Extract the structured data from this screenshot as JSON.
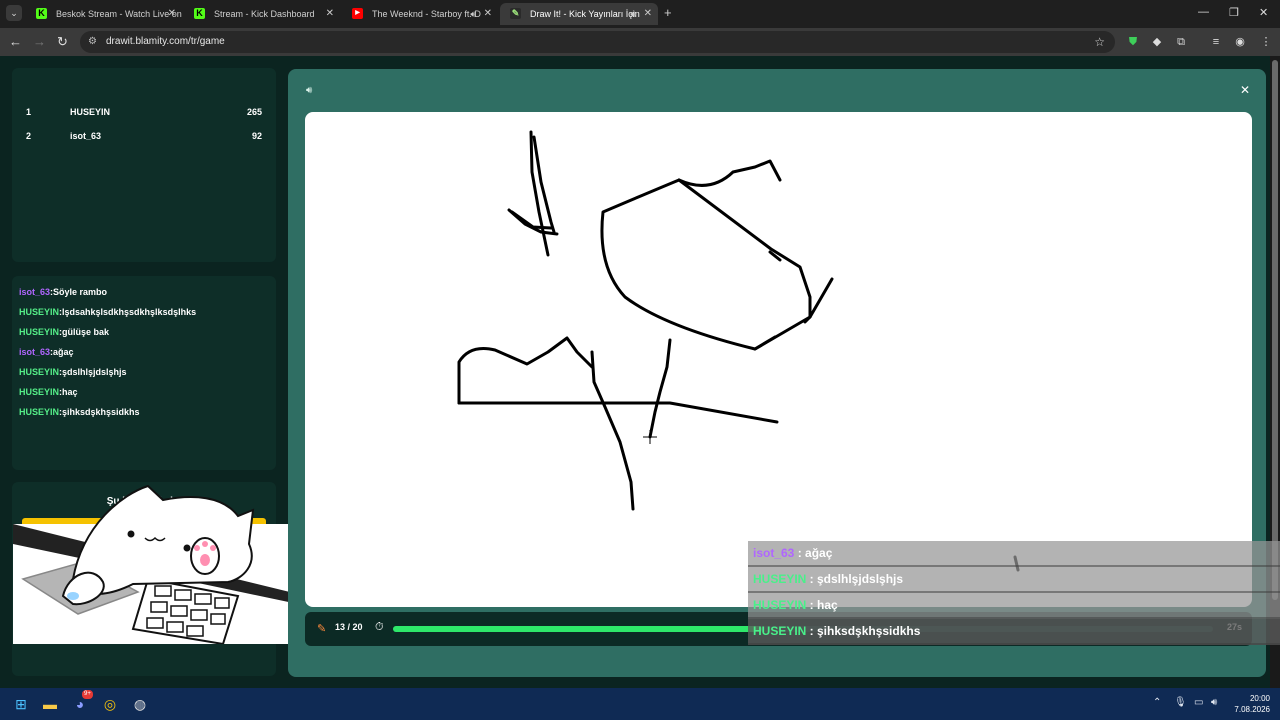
{
  "browser": {
    "tabs": [
      {
        "title": "Beskok Stream - Watch Live on",
        "favicon": "K"
      },
      {
        "title": "Stream - Kick Dashboard",
        "favicon": "K"
      },
      {
        "title": "The Weeknd - Starboy ft. D",
        "favicon": "▶"
      },
      {
        "title": "Draw It! - Kick Yayınları İçin",
        "favicon": "✎"
      }
    ],
    "url": "drawit.blamity.com/tr/game"
  },
  "scoreboard": [
    {
      "rank": "1",
      "name": "HUSEYIN",
      "score": "265"
    },
    {
      "rank": "2",
      "name": "isot_63",
      "score": "92"
    }
  ],
  "chat": [
    {
      "user": "isot_63",
      "message": "Söyle rambo",
      "color": "purple"
    },
    {
      "user": "HUSEYIN",
      "message": "lşdsahkşlsdkhşsdkhşlksdşlhks",
      "color": "green"
    },
    {
      "user": "HUSEYIN",
      "message": "gülüşe bak",
      "color": "green"
    },
    {
      "user": "isot_63",
      "message": "ağaç",
      "color": "purple"
    },
    {
      "user": "HUSEYIN",
      "message": "şdslhlşjdslşhjs",
      "color": "green"
    },
    {
      "user": "HUSEYIN",
      "message": "haç",
      "color": "green"
    },
    {
      "user": "HUSEYIN",
      "message": "şihksdşkhşsidkhs",
      "color": "green"
    }
  ],
  "word_panel": {
    "title": "Şu kelimeyi çiz:"
  },
  "game": {
    "round": "13 / 20",
    "time_left": "27s",
    "progress": 0.45
  },
  "overlay_chat": [
    {
      "user": "isot_63",
      "message": " : ağaç",
      "color": "purple"
    },
    {
      "user": "HUSEYIN",
      "message": " : şdslhlşjdslşhjs",
      "color": "green"
    },
    {
      "user": "HUSEYIN",
      "message": " : haç",
      "color": "green"
    },
    {
      "user": "HUSEYIN",
      "message": " : şihksdşkhşsidkhs",
      "color": "green"
    }
  ],
  "taskbar": {
    "time": "20:00",
    "date": "7.08.2026",
    "discord_badge": "9+"
  },
  "colors": {
    "accent_green": "#2ee86a",
    "username_green": "#55ee88",
    "username_purple": "#b066ff",
    "word_button": "#f5c200"
  }
}
